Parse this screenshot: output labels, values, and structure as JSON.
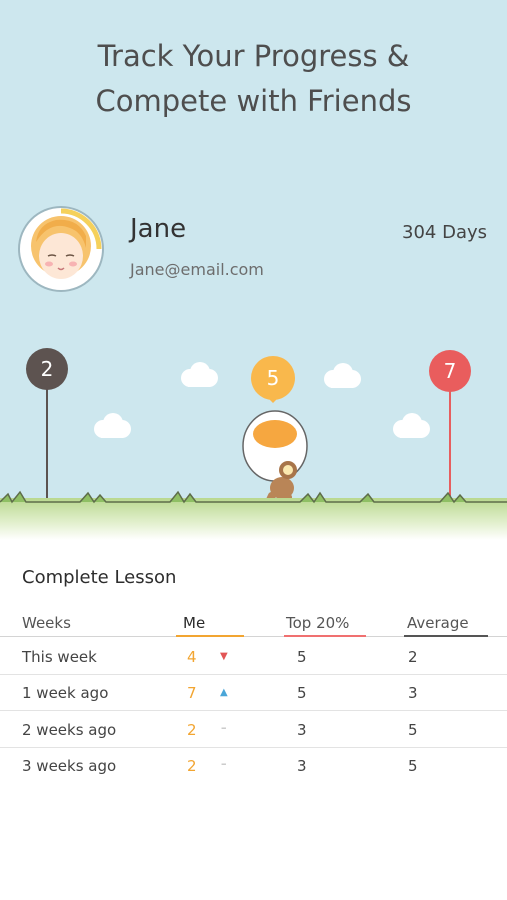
{
  "headline": {
    "line1": "Track Your Progress &",
    "line2": "Compete with Friends"
  },
  "profile": {
    "name": "Jane",
    "email": "Jane@email.com",
    "days": "304 Days"
  },
  "markers": {
    "left": "2",
    "center": "5",
    "right": "7"
  },
  "colors": {
    "accent": "#f2a531",
    "top": "#f07070",
    "average": "#555555",
    "sky": "#cde7ee"
  },
  "table": {
    "title": "Complete Lesson",
    "columns": [
      "Weeks",
      "Me",
      "Top 20%",
      "Average"
    ],
    "rows": [
      {
        "label": "This week",
        "me": "4",
        "trend": "▼",
        "top": "5",
        "avg": "2"
      },
      {
        "label": "1 week ago",
        "me": "7",
        "trend": "▲",
        "top": "5",
        "avg": "3"
      },
      {
        "label": "2 weeks ago",
        "me": "2",
        "trend": "–",
        "top": "3",
        "avg": "5"
      },
      {
        "label": "3 weeks ago",
        "me": "2",
        "trend": "–",
        "top": "3",
        "avg": "5"
      }
    ]
  }
}
